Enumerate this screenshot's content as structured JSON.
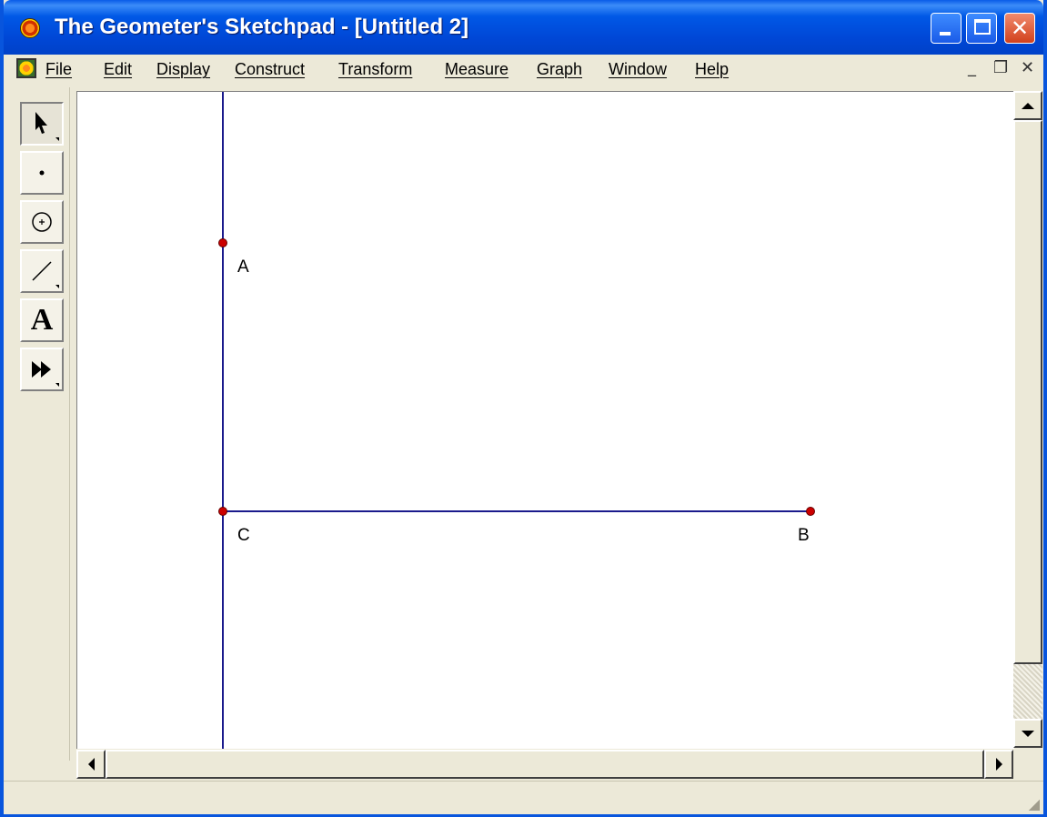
{
  "window": {
    "title": "The Geometer's Sketchpad - [Untitled 2]",
    "icon": "sketchpad-app-icon",
    "caption_buttons": [
      "minimize-icon",
      "maximize-icon",
      "close-icon"
    ],
    "close_glyph": "✕"
  },
  "menubar": {
    "items": [
      "File",
      "Edit",
      "Display",
      "Construct",
      "Transform",
      "Measure",
      "Graph",
      "Window",
      "Help"
    ],
    "mdi": {
      "minimize": "_",
      "restore": "❐",
      "close": "✕"
    }
  },
  "toolbox": {
    "tools": [
      {
        "name": "selection-arrow-tool",
        "icon": "arrow-cursor-icon",
        "active": true
      },
      {
        "name": "point-tool",
        "icon": "point-icon",
        "active": false
      },
      {
        "name": "compass-tool",
        "icon": "circle-icon",
        "active": false
      },
      {
        "name": "straightedge-tool",
        "icon": "segment-icon",
        "active": false
      },
      {
        "name": "text-tool",
        "icon": "text-icon",
        "label": "A",
        "active": false
      },
      {
        "name": "custom-tool",
        "icon": "fast-forward-icon",
        "active": false
      }
    ]
  },
  "sketch": {
    "points": [
      {
        "label": "A"
      },
      {
        "label": "C"
      },
      {
        "label": "B"
      }
    ],
    "objects": [
      "vertical line through A and C",
      "segment CB"
    ],
    "colors": {
      "line": "#1a1a8c",
      "point": "#cc0000",
      "label": "#000000"
    }
  }
}
